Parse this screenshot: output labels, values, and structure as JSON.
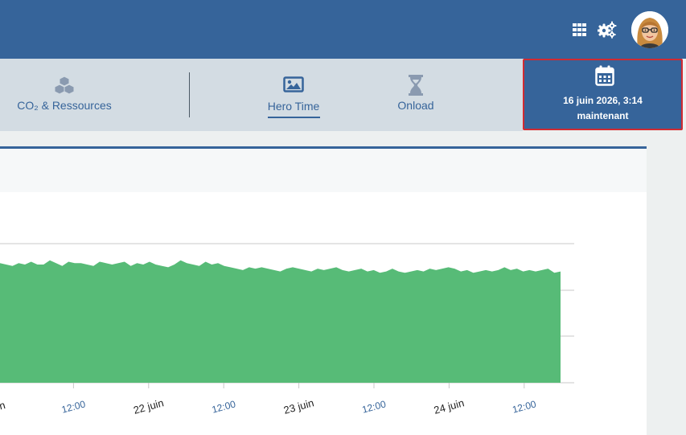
{
  "header": {
    "icons": [
      "grid-icon",
      "gears-icon"
    ],
    "avatar_icon": "user-avatar-icon"
  },
  "tabs": [
    {
      "label": "CO₂ & Ressources",
      "icon": "cubes-icon",
      "active": false
    },
    {
      "label": "Hero Time",
      "icon": "image-icon",
      "active": true
    },
    {
      "label": "Onload",
      "icon": "hourglass-icon",
      "active": false
    }
  ],
  "date_picker": {
    "icon": "calendar-icon",
    "date": "16 juin 2026, 3:14",
    "relative": "maintenant"
  },
  "colors": {
    "primary": "#36649a",
    "tab_bar": "#d3dce3",
    "highlight_border": "#d12a32",
    "series_fill": "#57bb77"
  },
  "chart_data": {
    "type": "area",
    "x_ticks": [
      {
        "label": "uin",
        "major": true
      },
      {
        "label": "12:00",
        "major": false
      },
      {
        "label": "22 juin",
        "major": true
      },
      {
        "label": "12:00",
        "major": false
      },
      {
        "label": "23 juin",
        "major": true
      },
      {
        "label": "12:00",
        "major": false
      },
      {
        "label": "24 juin",
        "major": true
      },
      {
        "label": "12:00",
        "major": false
      }
    ],
    "ylim": [
      0,
      100
    ],
    "grid": true,
    "series": [
      {
        "values": [
          86,
          85,
          84,
          86,
          85,
          87,
          85,
          85,
          88,
          86,
          84,
          87,
          86,
          86,
          85,
          84,
          87,
          86,
          85,
          86,
          87,
          84,
          86,
          85,
          87,
          85,
          84,
          83,
          85,
          88,
          86,
          85,
          84,
          87,
          85,
          86,
          84,
          83,
          82,
          81,
          83,
          82,
          83,
          82,
          81,
          80,
          82,
          83,
          82,
          81,
          80,
          82,
          81,
          82,
          83,
          81,
          80,
          81,
          82,
          80,
          81,
          79,
          80,
          82,
          80,
          79,
          80,
          81,
          80,
          82,
          81,
          82,
          83,
          82,
          80,
          81,
          79,
          80,
          81,
          80,
          81,
          83,
          81,
          82,
          80,
          81,
          80,
          81,
          82,
          79,
          80
        ]
      }
    ]
  }
}
